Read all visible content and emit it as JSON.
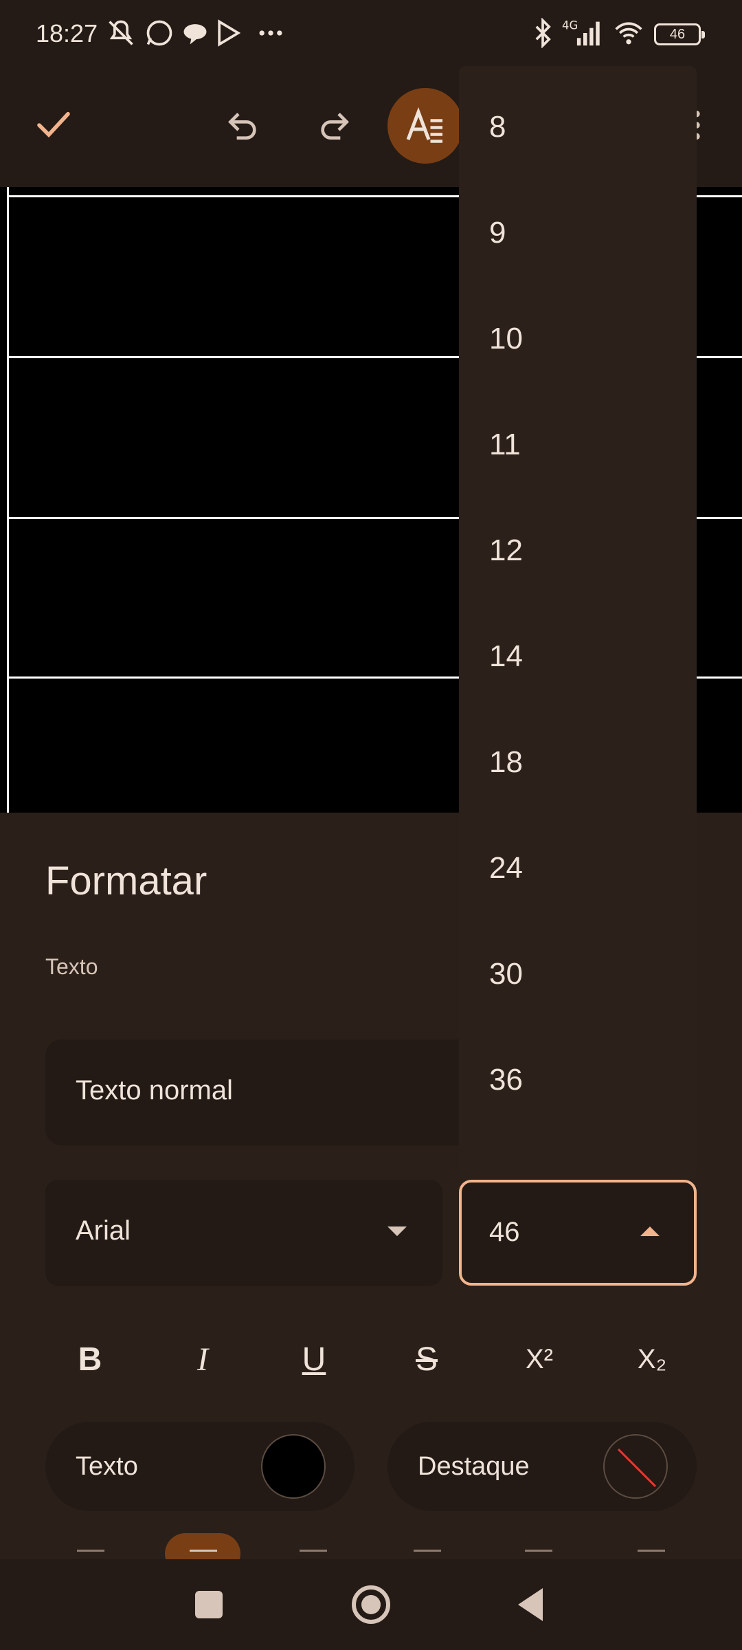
{
  "status_bar": {
    "time": "18:27",
    "battery": "46",
    "icons": [
      "mute-icon",
      "whatsapp-icon",
      "chat-icon",
      "play-store-icon",
      "more-icon",
      "bluetooth-icon",
      "4g-signal-icon",
      "wifi-icon",
      "battery-icon"
    ]
  },
  "toolbar": {
    "icons": [
      "check-icon",
      "undo-icon",
      "redo-icon",
      "text-format-icon",
      "more-vert-icon"
    ]
  },
  "format_panel": {
    "title": "Formatar",
    "section_label": "Texto",
    "paragraph_style": "Texto normal",
    "font_family": "Arial",
    "font_size": "46",
    "style_buttons": [
      {
        "name": "bold",
        "label": "B"
      },
      {
        "name": "italic",
        "label": "I"
      },
      {
        "name": "underline",
        "label": "U"
      },
      {
        "name": "strikethrough",
        "label": "S"
      },
      {
        "name": "superscript",
        "label": "X²"
      },
      {
        "name": "subscript",
        "label": "X₂"
      }
    ],
    "text_color_label": "Texto",
    "highlight_label": "Destaque",
    "colors": {
      "text_color": "#000000",
      "accent": "#f2b48d",
      "selected": "#7a3e14"
    }
  },
  "size_menu": {
    "options": [
      "8",
      "9",
      "10",
      "11",
      "12",
      "14",
      "18",
      "24",
      "30",
      "36"
    ]
  }
}
